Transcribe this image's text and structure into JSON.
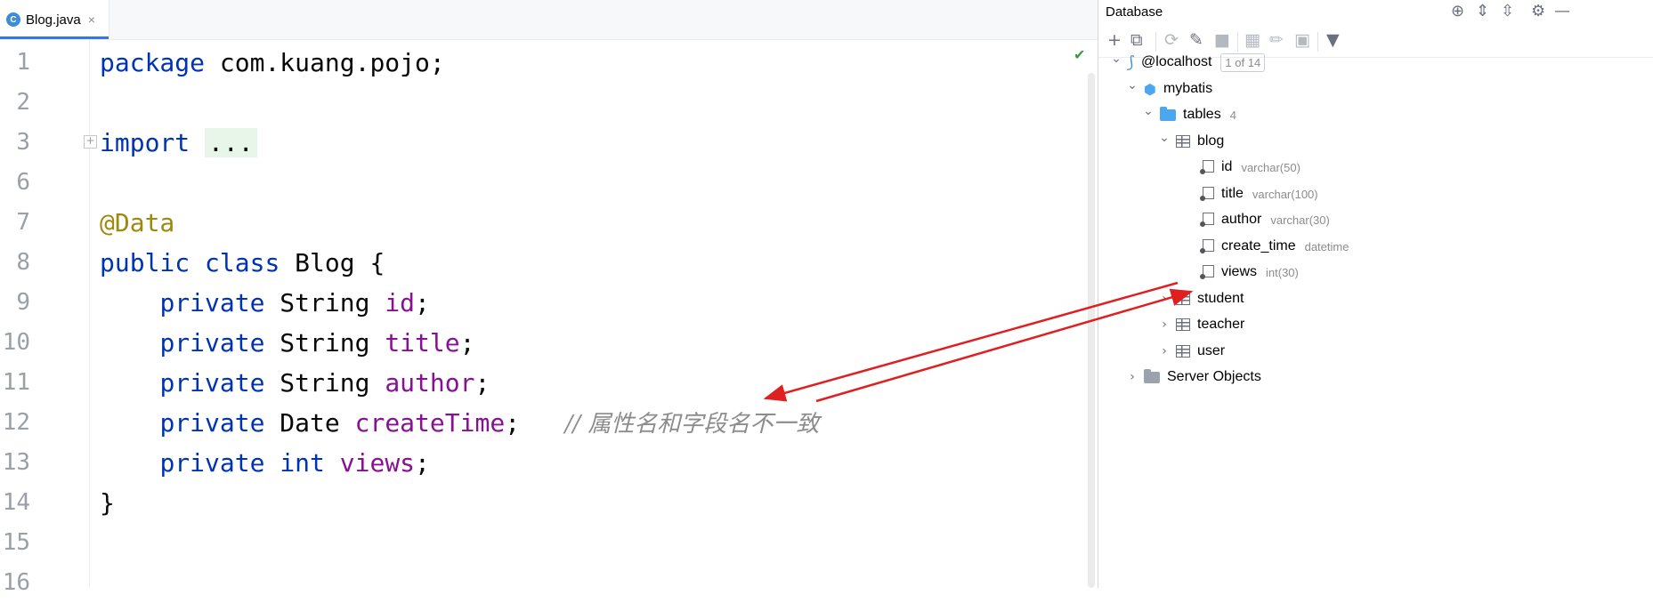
{
  "editor": {
    "tab": {
      "icon_letter": "C",
      "filename": "Blog.java",
      "close": "×"
    },
    "lines": [
      {
        "num": "1",
        "segments": [
          {
            "t": "package",
            "c": "kw"
          },
          {
            "t": " com.kuang.pojo;",
            "c": ""
          }
        ]
      },
      {
        "num": "2",
        "segments": []
      },
      {
        "num": "3",
        "segments": [
          {
            "t": "import",
            "c": "kw"
          },
          {
            "t": " ",
            "c": ""
          },
          {
            "t": "...",
            "c": "fold-import"
          }
        ],
        "fold": "+"
      },
      {
        "num": "6",
        "segments": []
      },
      {
        "num": "7",
        "segments": [
          {
            "t": "@Data",
            "c": "ann"
          }
        ]
      },
      {
        "num": "8",
        "segments": [
          {
            "t": "public",
            "c": "kw"
          },
          {
            "t": " ",
            "c": ""
          },
          {
            "t": "class",
            "c": "kw"
          },
          {
            "t": " Blog {",
            "c": ""
          }
        ]
      },
      {
        "num": "9",
        "segments": [
          {
            "t": "    ",
            "c": ""
          },
          {
            "t": "private",
            "c": "kw"
          },
          {
            "t": " String ",
            "c": ""
          },
          {
            "t": "id",
            "c": "fld"
          },
          {
            "t": ";",
            "c": ""
          }
        ]
      },
      {
        "num": "10",
        "segments": [
          {
            "t": "    ",
            "c": ""
          },
          {
            "t": "private",
            "c": "kw"
          },
          {
            "t": " String ",
            "c": ""
          },
          {
            "t": "title",
            "c": "fld"
          },
          {
            "t": ";",
            "c": ""
          }
        ]
      },
      {
        "num": "11",
        "segments": [
          {
            "t": "    ",
            "c": ""
          },
          {
            "t": "private",
            "c": "kw"
          },
          {
            "t": " String ",
            "c": ""
          },
          {
            "t": "author",
            "c": "fld"
          },
          {
            "t": ";",
            "c": ""
          }
        ]
      },
      {
        "num": "12",
        "segments": [
          {
            "t": "    ",
            "c": ""
          },
          {
            "t": "private",
            "c": "kw"
          },
          {
            "t": " Date ",
            "c": ""
          },
          {
            "t": "createTime",
            "c": "fld"
          },
          {
            "t": ";   ",
            "c": ""
          },
          {
            "t": "// 属性名和字段名不一致",
            "c": "cmt"
          }
        ]
      },
      {
        "num": "13",
        "segments": [
          {
            "t": "    ",
            "c": ""
          },
          {
            "t": "private",
            "c": "kw"
          },
          {
            "t": " ",
            "c": ""
          },
          {
            "t": "int",
            "c": "kw"
          },
          {
            "t": " ",
            "c": ""
          },
          {
            "t": "views",
            "c": "fld"
          },
          {
            "t": ";",
            "c": ""
          }
        ]
      },
      {
        "num": "14",
        "segments": [
          {
            "t": "}",
            "c": ""
          }
        ]
      },
      {
        "num": "15",
        "segments": []
      },
      {
        "num": "16",
        "segments": []
      }
    ],
    "inspection_icon": "check-icon"
  },
  "database": {
    "title": "Database",
    "tree": [
      {
        "id": "host",
        "label": "@localhost",
        "pager": "1 of 14",
        "chevron": "open",
        "icon": "mysql"
      },
      {
        "id": "schema",
        "label": "mybatis",
        "chevron": "open",
        "icon": "schema"
      },
      {
        "id": "tables",
        "label": "tables",
        "sub": "4",
        "chevron": "open",
        "icon": "folder"
      },
      {
        "id": "blog",
        "label": "blog",
        "chevron": "open",
        "icon": "table"
      },
      {
        "id": "col-id",
        "label": "id",
        "sub": "varchar(50)",
        "icon": "column"
      },
      {
        "id": "col-title",
        "label": "title",
        "sub": "varchar(100)",
        "icon": "column"
      },
      {
        "id": "col-author",
        "label": "author",
        "sub": "varchar(30)",
        "icon": "column"
      },
      {
        "id": "col-create_time",
        "label": "create_time",
        "sub": "datetime",
        "icon": "column"
      },
      {
        "id": "col-views",
        "label": "views",
        "sub": "int(30)",
        "icon": "column"
      },
      {
        "id": "student",
        "label": "student",
        "chevron": "closed",
        "icon": "table"
      },
      {
        "id": "teacher",
        "label": "teacher",
        "chevron": "closed",
        "icon": "table"
      },
      {
        "id": "user",
        "label": "user",
        "chevron": "closed",
        "icon": "table"
      },
      {
        "id": "server-objects",
        "label": "Server Objects",
        "chevron": "closed",
        "icon": "folder-grey"
      }
    ]
  },
  "colors": {
    "keyword": "#0033b3",
    "annotation": "#9e880d",
    "field": "#871094",
    "comment": "#8c8c8c",
    "arrow": "#e02020"
  }
}
